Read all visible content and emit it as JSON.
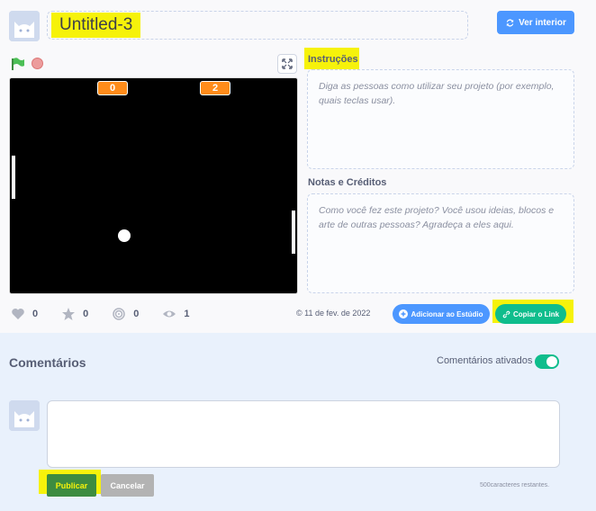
{
  "project": {
    "title": "Untitled-3",
    "see_inside_label": "Ver interior"
  },
  "stage": {
    "score_left": "0",
    "score_right": "2"
  },
  "stats": {
    "loves": "0",
    "favorites": "0",
    "remixes": "0",
    "views": "1"
  },
  "date_text": "© 11 de fev. de 2022",
  "actions": {
    "add_studio_label": "Adicionar ao Estúdio",
    "copy_link_label": "Copiar o Link"
  },
  "instructions": {
    "heading": "Instruções",
    "placeholder": "Diga as pessoas como utilizar seu projeto (por exemplo, quais teclas usar)."
  },
  "notes": {
    "heading": "Notas e Créditos",
    "placeholder": "Como você fez este projeto? Você usou ideias, blocos e arte de outras pessoas? Agradeça a eles aqui."
  },
  "comments": {
    "title": "Comentários",
    "toggle_label": "Comentários ativados",
    "toggle_on": true,
    "publish_label": "Publicar",
    "cancel_label": "Cancelar",
    "chars_remaining": "500caracteres restantes."
  },
  "colors": {
    "highlight": "#f6f20a",
    "primary_blue": "#4c97ff",
    "green": "#0fbd8c",
    "stage_bg": "#000000",
    "score_orange": "#ff8c1a"
  }
}
